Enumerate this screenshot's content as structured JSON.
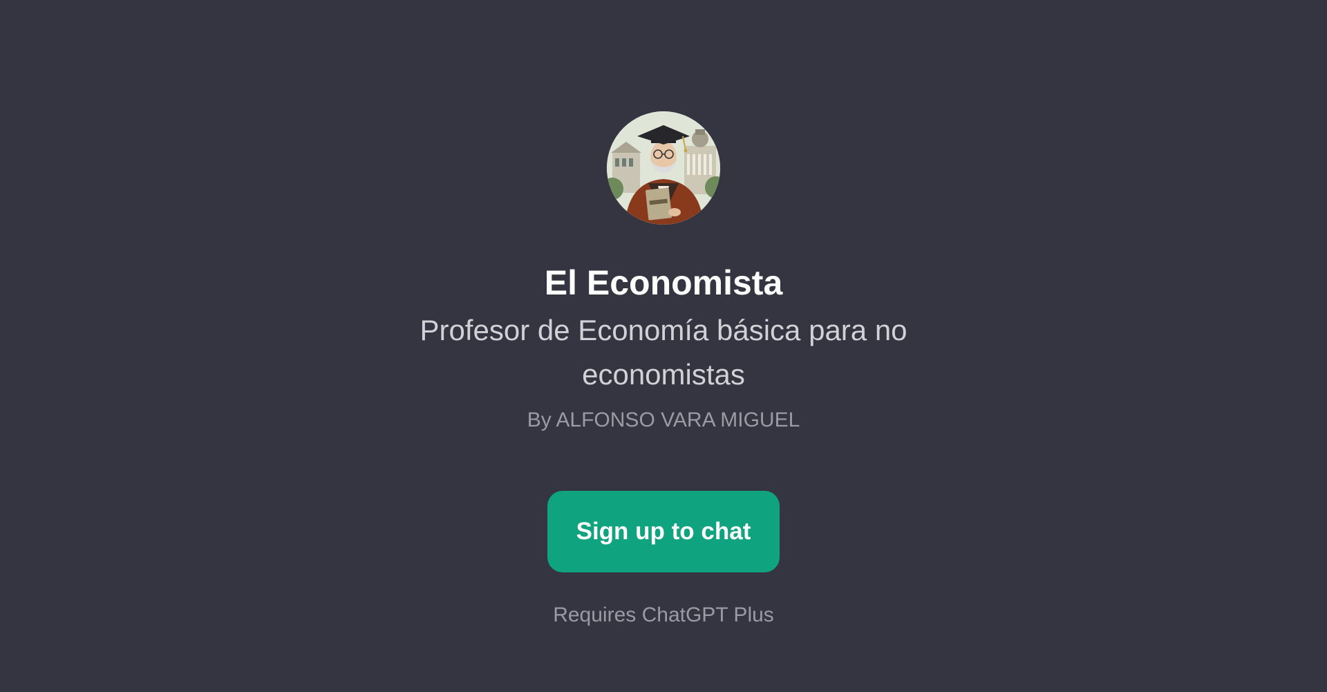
{
  "gpt": {
    "avatar_icon": "professor-portrait-icon",
    "avatar_book_text": "ECONOMICS",
    "title": "El Economista",
    "description": "Profesor de Economía básica para no economistas",
    "author": "By ALFONSO VARA MIGUEL"
  },
  "cta": {
    "signup_label": "Sign up to chat",
    "requirement": "Requires ChatGPT Plus"
  },
  "colors": {
    "background": "#343541",
    "accent": "#10a37f",
    "title": "#ffffff",
    "subtitle": "#d1d1d8",
    "muted": "#9b9ba5"
  }
}
